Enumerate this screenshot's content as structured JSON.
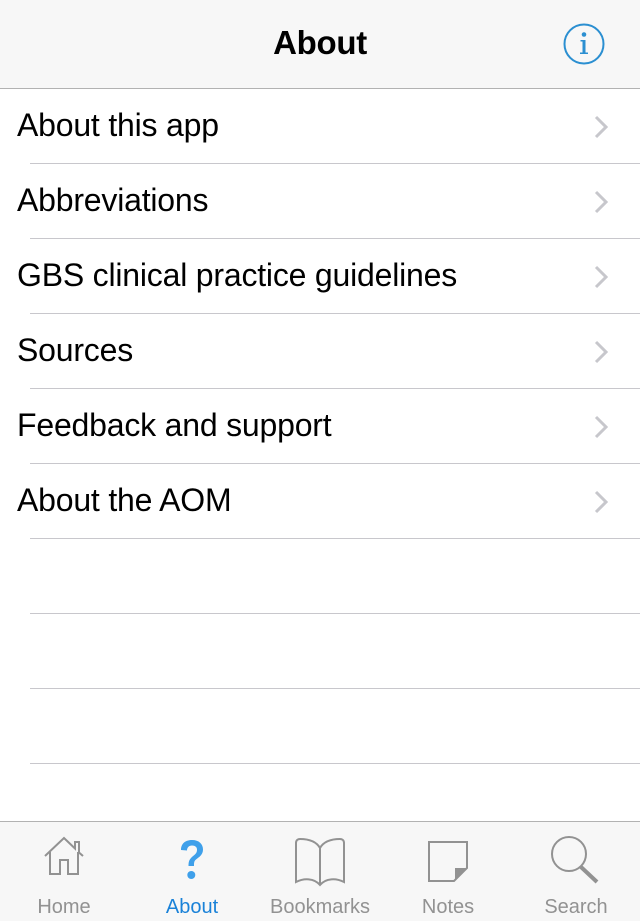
{
  "navbar": {
    "title": "About",
    "info_icon": "info-circle-icon"
  },
  "list": {
    "items": [
      {
        "label": "About this app"
      },
      {
        "label": "Abbreviations"
      },
      {
        "label": "GBS clinical practice guidelines"
      },
      {
        "label": "Sources"
      },
      {
        "label": "Feedback and support"
      },
      {
        "label": "About the AOM"
      }
    ]
  },
  "tabbar": {
    "tabs": [
      {
        "label": "Home",
        "icon": "home-icon",
        "active": false
      },
      {
        "label": "About",
        "icon": "question-mark-icon",
        "active": true
      },
      {
        "label": "Bookmarks",
        "icon": "book-icon",
        "active": false
      },
      {
        "label": "Notes",
        "icon": "note-icon",
        "active": false
      },
      {
        "label": "Search",
        "icon": "search-icon",
        "active": false
      }
    ]
  },
  "colors": {
    "accent": "#2b8fd1",
    "active_tab": "#1a82d8",
    "inactive_tab": "#929292",
    "separator": "#c8c7cc",
    "bar_background": "#f7f7f7"
  }
}
